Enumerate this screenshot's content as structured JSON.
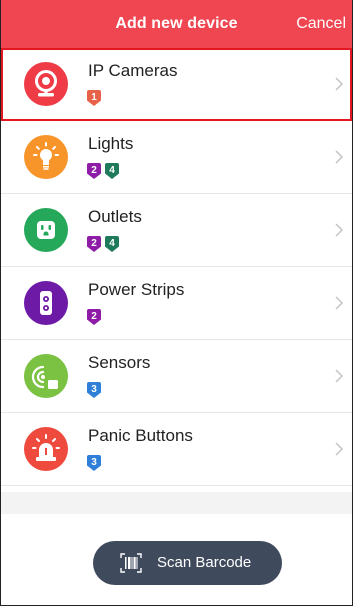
{
  "header": {
    "title": "Add new device",
    "cancel_label": "Cancel"
  },
  "colors": {
    "header_bg": "#ef4651",
    "selected_border": "#e3171f",
    "scan_button_bg": "#3f4a5c"
  },
  "devices": [
    {
      "name": "IP Cameras",
      "icon": "webcam-icon",
      "icon_color": "#ef3b45",
      "selected": true,
      "badges": [
        {
          "value": "1",
          "color": "#e8624a"
        }
      ]
    },
    {
      "name": "Lights",
      "icon": "lightbulb-icon",
      "icon_color": "#f8952a",
      "selected": false,
      "badges": [
        {
          "value": "2",
          "color": "#8e1ca6"
        },
        {
          "value": "4",
          "color": "#1f7a5c"
        }
      ]
    },
    {
      "name": "Outlets",
      "icon": "outlet-icon",
      "icon_color": "#25a85a",
      "selected": false,
      "badges": [
        {
          "value": "2",
          "color": "#8e1ca6"
        },
        {
          "value": "4",
          "color": "#1f7a5c"
        }
      ]
    },
    {
      "name": "Power Strips",
      "icon": "power-strip-icon",
      "icon_color": "#6d1aa6",
      "selected": false,
      "badges": [
        {
          "value": "2",
          "color": "#8e1ca6"
        }
      ]
    },
    {
      "name": "Sensors",
      "icon": "sensor-icon",
      "icon_color": "#7bc142",
      "selected": false,
      "badges": [
        {
          "value": "3",
          "color": "#2f7fd8"
        }
      ]
    },
    {
      "name": "Panic Buttons",
      "icon": "siren-icon",
      "icon_color": "#ef4a3e",
      "selected": false,
      "badges": [
        {
          "value": "3",
          "color": "#2f7fd8"
        }
      ]
    }
  ],
  "footer": {
    "scan_label": "Scan Barcode",
    "scan_icon": "barcode-icon"
  }
}
